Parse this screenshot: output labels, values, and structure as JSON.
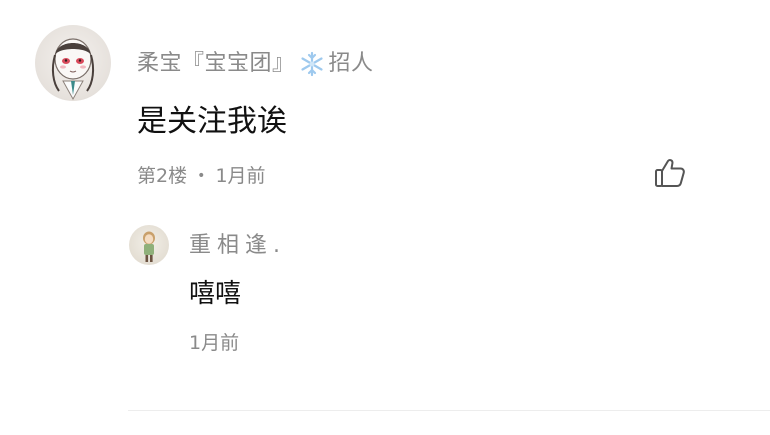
{
  "comment": {
    "username": "柔宝『宝宝团』",
    "badge_icon": "snowflake-icon",
    "badge_suffix": "招人",
    "text": "是关注我诶",
    "floor": "第2楼",
    "separator": "•",
    "time": "1月前",
    "like_icon": "thumbs-up-icon"
  },
  "reply": {
    "username": "重相逢.",
    "text": "嘻嘻",
    "time": "1月前"
  },
  "colors": {
    "meta_gray": "#8a8a8a",
    "text": "#111111",
    "snowflake": "#9ec9ee"
  }
}
